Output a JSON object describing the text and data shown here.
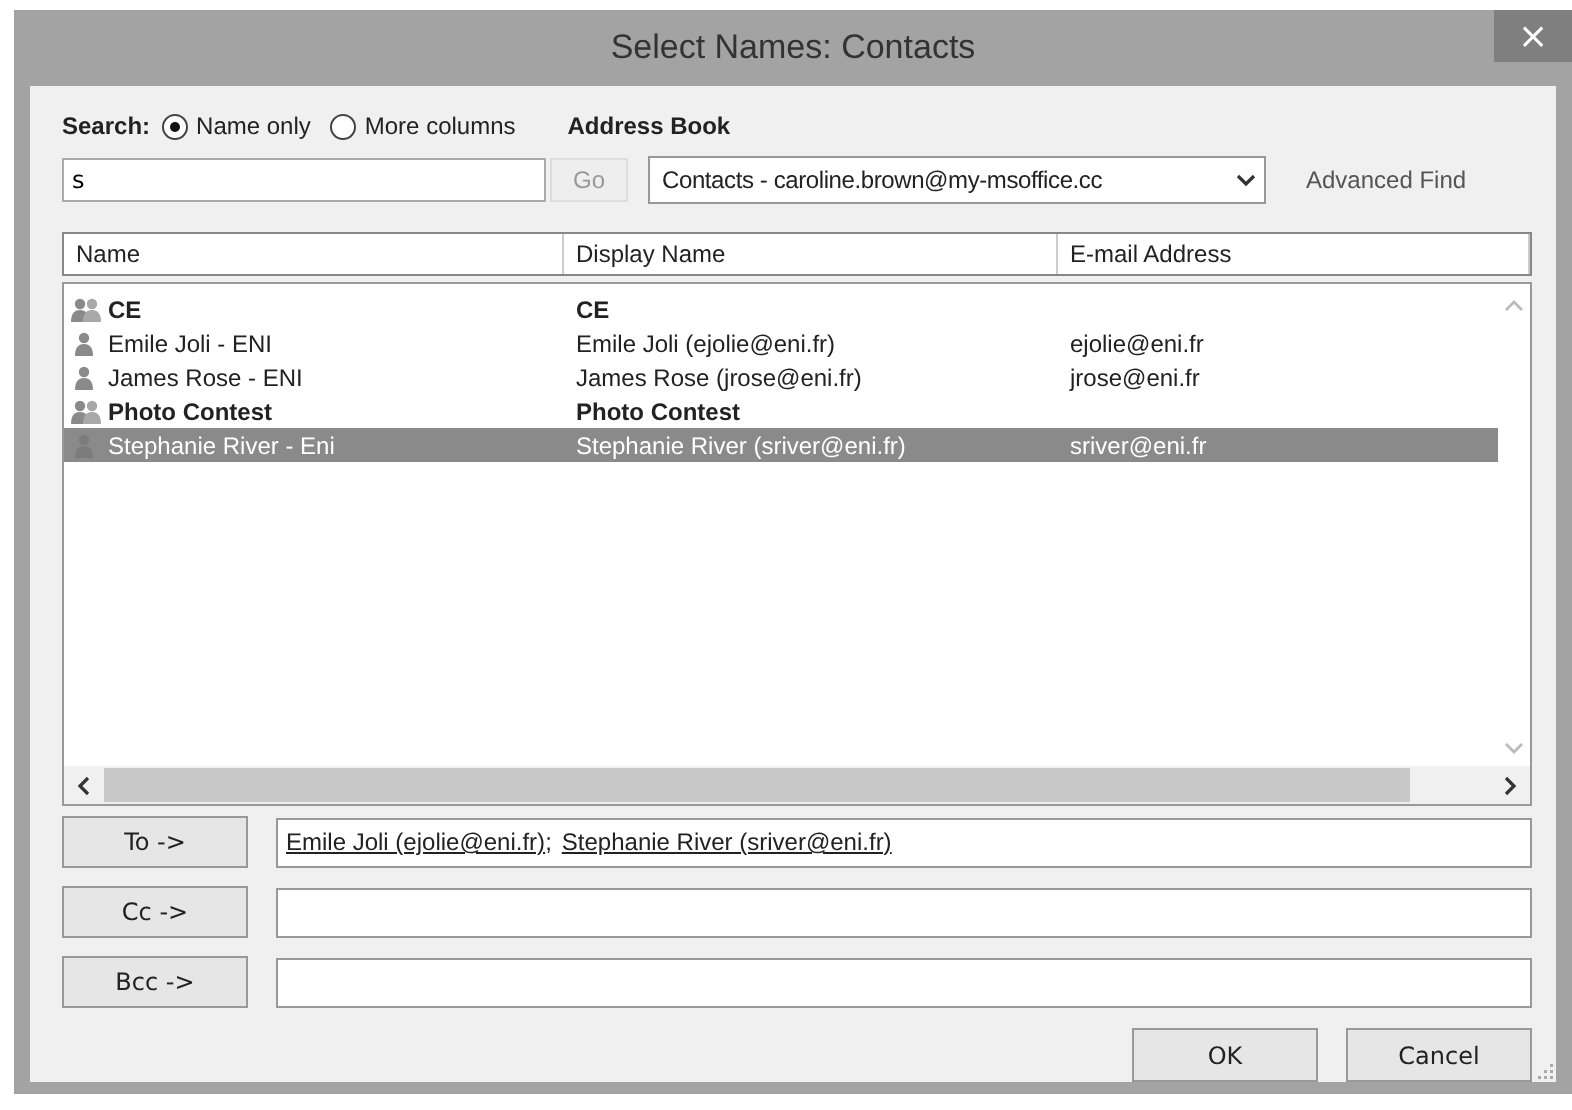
{
  "window": {
    "title": "Select Names: Contacts",
    "close": "×"
  },
  "search": {
    "label": "Search:",
    "options": [
      {
        "label": "Name only",
        "selected": true
      },
      {
        "label": "More columns",
        "selected": false
      }
    ],
    "value": "s",
    "go": {
      "label": "Go",
      "disabled": true
    }
  },
  "address_book": {
    "label": "Address Book",
    "value": "Contacts - caroline.brown@my-msoffice.cc"
  },
  "advanced_find": {
    "label": "Advanced Find"
  },
  "table": {
    "columns": [
      "Name",
      "Display Name",
      "E-mail Address"
    ],
    "rows": [
      {
        "kind": "group",
        "cells": [
          "CE",
          "CE",
          ""
        ],
        "selected": false
      },
      {
        "kind": "contact",
        "cells": [
          "Emile Joli - ENI",
          "Emile Joli (ejolie@eni.fr)",
          "ejolie@eni.fr"
        ],
        "selected": false
      },
      {
        "kind": "contact",
        "cells": [
          "James Rose - ENI",
          "James Rose (jrose@eni.fr)",
          "jrose@eni.fr"
        ],
        "selected": false
      },
      {
        "kind": "group",
        "cells": [
          "Photo Contest",
          "Photo Contest",
          ""
        ],
        "selected": false
      },
      {
        "kind": "contact",
        "cells": [
          "Stephanie River - Eni",
          "Stephanie River (sriver@eni.fr)",
          "sriver@eni.fr"
        ],
        "selected": true
      }
    ]
  },
  "recipients": {
    "separator": ";",
    "fields": [
      {
        "button": "To ->",
        "names": [
          "Emile Joli (ejolie@eni.fr)",
          "Stephanie River (sriver@eni.fr)"
        ]
      },
      {
        "button": "Cc ->"
      },
      {
        "button": "Bcc ->"
      }
    ]
  },
  "buttons": [
    "OK",
    "Cancel"
  ]
}
